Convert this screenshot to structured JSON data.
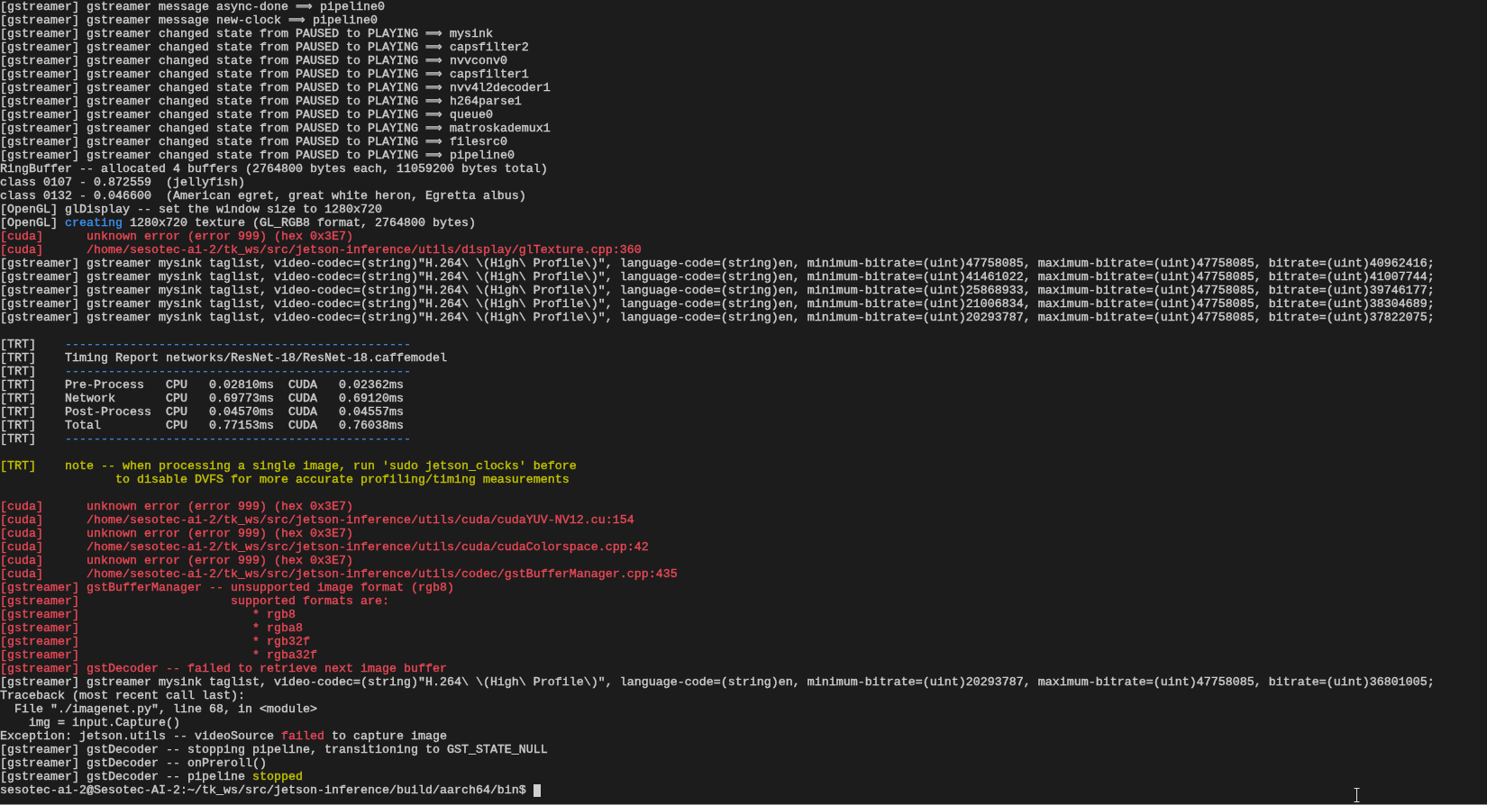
{
  "terminal": {
    "lines": [
      {
        "kind": "text",
        "segments": [
          {
            "text": "[gstreamer] gstreamer message async-done ⟹ pipeline0",
            "color": "#cccccc"
          }
        ]
      },
      {
        "kind": "text",
        "segments": [
          {
            "text": "[gstreamer] gstreamer message new-clock ⟹ pipeline0",
            "color": "#cccccc"
          }
        ]
      },
      {
        "kind": "text",
        "segments": [
          {
            "text": "[gstreamer] gstreamer changed state from PAUSED to PLAYING ⟹ mysink",
            "color": "#cccccc"
          }
        ]
      },
      {
        "kind": "text",
        "segments": [
          {
            "text": "[gstreamer] gstreamer changed state from PAUSED to PLAYING ⟹ capsfilter2",
            "color": "#cccccc"
          }
        ]
      },
      {
        "kind": "text",
        "segments": [
          {
            "text": "[gstreamer] gstreamer changed state from PAUSED to PLAYING ⟹ nvvconv0",
            "color": "#cccccc"
          }
        ]
      },
      {
        "kind": "text",
        "segments": [
          {
            "text": "[gstreamer] gstreamer changed state from PAUSED to PLAYING ⟹ capsfilter1",
            "color": "#cccccc"
          }
        ]
      },
      {
        "kind": "text",
        "segments": [
          {
            "text": "[gstreamer] gstreamer changed state from PAUSED to PLAYING ⟹ nvv4l2decoder1",
            "color": "#cccccc"
          }
        ]
      },
      {
        "kind": "text",
        "segments": [
          {
            "text": "[gstreamer] gstreamer changed state from PAUSED to PLAYING ⟹ h264parse1",
            "color": "#cccccc"
          }
        ]
      },
      {
        "kind": "text",
        "segments": [
          {
            "text": "[gstreamer] gstreamer changed state from PAUSED to PLAYING ⟹ queue0",
            "color": "#cccccc"
          }
        ]
      },
      {
        "kind": "text",
        "segments": [
          {
            "text": "[gstreamer] gstreamer changed state from PAUSED to PLAYING ⟹ matroskademux1",
            "color": "#cccccc"
          }
        ]
      },
      {
        "kind": "text",
        "segments": [
          {
            "text": "[gstreamer] gstreamer changed state from PAUSED to PLAYING ⟹ filesrc0",
            "color": "#cccccc"
          }
        ]
      },
      {
        "kind": "text",
        "segments": [
          {
            "text": "[gstreamer] gstreamer changed state from PAUSED to PLAYING ⟹ pipeline0",
            "color": "#cccccc"
          }
        ]
      },
      {
        "kind": "text",
        "segments": [
          {
            "text": "RingBuffer -- allocated 4 buffers (2764800 bytes each, 11059200 bytes total)",
            "color": "#cccccc"
          }
        ]
      },
      {
        "kind": "text",
        "segments": [
          {
            "text": "class 0107 - 0.872559  (jellyfish)",
            "color": "#cccccc"
          }
        ]
      },
      {
        "kind": "text",
        "segments": [
          {
            "text": "class 0132 - 0.046600  (American egret, great white heron, Egretta albus)",
            "color": "#cccccc"
          }
        ]
      },
      {
        "kind": "text",
        "segments": [
          {
            "text": "[OpenGL] glDisplay -- set the window size to 1280x720",
            "color": "#cccccc"
          }
        ]
      },
      {
        "kind": "text",
        "segments": [
          {
            "text": "[OpenGL] ",
            "color": "#cccccc"
          },
          {
            "text": "creating",
            "color": "#3b8eea"
          },
          {
            "text": " 1280x720 texture (GL_RGB8 format, 2764800 bytes)",
            "color": "#cccccc"
          }
        ]
      },
      {
        "kind": "text",
        "segments": [
          {
            "text": "[cuda]      unknown error (error 999) (hex 0x3E7)",
            "color": "#e74856"
          }
        ]
      },
      {
        "kind": "text",
        "segments": [
          {
            "text": "[cuda]      /home/sesotec-ai-2/tk_ws/src/jetson-inference/utils/display/glTexture.cpp:360",
            "color": "#e74856"
          }
        ]
      },
      {
        "kind": "text",
        "segments": [
          {
            "text": "[gstreamer] gstreamer mysink taglist, video-codec=(string)\"H.264\\ \\(High\\ Profile\\)\", language-code=(string)en, minimum-bitrate=(uint)47758085, maximum-bitrate=(uint)47758085, bitrate=(uint)40962416;",
            "color": "#cccccc"
          }
        ]
      },
      {
        "kind": "text",
        "segments": [
          {
            "text": "[gstreamer] gstreamer mysink taglist, video-codec=(string)\"H.264\\ \\(High\\ Profile\\)\", language-code=(string)en, minimum-bitrate=(uint)41461022, maximum-bitrate=(uint)47758085, bitrate=(uint)41007744;",
            "color": "#cccccc"
          }
        ]
      },
      {
        "kind": "text",
        "segments": [
          {
            "text": "[gstreamer] gstreamer mysink taglist, video-codec=(string)\"H.264\\ \\(High\\ Profile\\)\", language-code=(string)en, minimum-bitrate=(uint)25868933, maximum-bitrate=(uint)47758085, bitrate=(uint)39746177;",
            "color": "#cccccc"
          }
        ]
      },
      {
        "kind": "text",
        "segments": [
          {
            "text": "[gstreamer] gstreamer mysink taglist, video-codec=(string)\"H.264\\ \\(High\\ Profile\\)\", language-code=(string)en, minimum-bitrate=(uint)21006834, maximum-bitrate=(uint)47758085, bitrate=(uint)38304689;",
            "color": "#cccccc"
          }
        ]
      },
      {
        "kind": "text",
        "segments": [
          {
            "text": "[gstreamer] gstreamer mysink taglist, video-codec=(string)\"H.264\\ \\(High\\ Profile\\)\", language-code=(string)en, minimum-bitrate=(uint)20293787, maximum-bitrate=(uint)47758085, bitrate=(uint)37822075;",
            "color": "#cccccc"
          }
        ]
      },
      {
        "kind": "blank"
      },
      {
        "kind": "text",
        "segments": [
          {
            "text": "[TRT]    ",
            "color": "#cccccc"
          },
          {
            "text": "------------------------------------------------",
            "color": "#3b8eea"
          }
        ]
      },
      {
        "kind": "text",
        "segments": [
          {
            "text": "[TRT]    Timing Report networks/ResNet-18/ResNet-18.caffemodel",
            "color": "#cccccc"
          }
        ]
      },
      {
        "kind": "text",
        "segments": [
          {
            "text": "[TRT]    ",
            "color": "#cccccc"
          },
          {
            "text": "------------------------------------------------",
            "color": "#3b8eea"
          }
        ]
      },
      {
        "kind": "text",
        "segments": [
          {
            "text": "[TRT]    Pre-Process   CPU   0.02810ms  CUDA   0.02362ms",
            "color": "#cccccc"
          }
        ]
      },
      {
        "kind": "text",
        "segments": [
          {
            "text": "[TRT]    Network       CPU   0.69773ms  CUDA   0.69120ms",
            "color": "#cccccc"
          }
        ]
      },
      {
        "kind": "text",
        "segments": [
          {
            "text": "[TRT]    Post-Process  CPU   0.04570ms  CUDA   0.04557ms",
            "color": "#cccccc"
          }
        ]
      },
      {
        "kind": "text",
        "segments": [
          {
            "text": "[TRT]    Total         CPU   0.77153ms  CUDA   0.76038ms",
            "color": "#cccccc"
          }
        ]
      },
      {
        "kind": "text",
        "segments": [
          {
            "text": "[TRT]    ",
            "color": "#cccccc"
          },
          {
            "text": "------------------------------------------------",
            "color": "#3b8eea"
          }
        ]
      },
      {
        "kind": "blank"
      },
      {
        "kind": "text",
        "segments": [
          {
            "text": "[TRT]    note -- when processing a single image, run 'sudo jetson_clocks' before",
            "color": "#c1c100"
          }
        ]
      },
      {
        "kind": "text",
        "segments": [
          {
            "text": "                to disable DVFS for more accurate profiling/timing measurements",
            "color": "#c1c100"
          }
        ]
      },
      {
        "kind": "blank"
      },
      {
        "kind": "text",
        "segments": [
          {
            "text": "[cuda]      unknown error (error 999) (hex 0x3E7)",
            "color": "#e74856"
          }
        ]
      },
      {
        "kind": "text",
        "segments": [
          {
            "text": "[cuda]      /home/sesotec-ai-2/tk_ws/src/jetson-inference/utils/cuda/cudaYUV-NV12.cu:154",
            "color": "#e74856"
          }
        ]
      },
      {
        "kind": "text",
        "segments": [
          {
            "text": "[cuda]      unknown error (error 999) (hex 0x3E7)",
            "color": "#e74856"
          }
        ]
      },
      {
        "kind": "text",
        "segments": [
          {
            "text": "[cuda]      /home/sesotec-ai-2/tk_ws/src/jetson-inference/utils/cuda/cudaColorspace.cpp:42",
            "color": "#e74856"
          }
        ]
      },
      {
        "kind": "text",
        "segments": [
          {
            "text": "[cuda]      unknown error (error 999) (hex 0x3E7)",
            "color": "#e74856"
          }
        ]
      },
      {
        "kind": "text",
        "segments": [
          {
            "text": "[cuda]      /home/sesotec-ai-2/tk_ws/src/jetson-inference/utils/codec/gstBufferManager.cpp:435",
            "color": "#e74856"
          }
        ]
      },
      {
        "kind": "text",
        "segments": [
          {
            "text": "[gstreamer] gstBufferManager -- unsupported image format (rgb8)",
            "color": "#e74856"
          }
        ]
      },
      {
        "kind": "text",
        "segments": [
          {
            "text": "[gstreamer]                     supported formats are:",
            "color": "#e74856"
          }
        ]
      },
      {
        "kind": "text",
        "segments": [
          {
            "text": "[gstreamer]                        * rgb8",
            "color": "#e74856"
          }
        ]
      },
      {
        "kind": "text",
        "segments": [
          {
            "text": "[gstreamer]                        * rgba8",
            "color": "#e74856"
          }
        ]
      },
      {
        "kind": "text",
        "segments": [
          {
            "text": "[gstreamer]                        * rgb32f",
            "color": "#e74856"
          }
        ]
      },
      {
        "kind": "text",
        "segments": [
          {
            "text": "[gstreamer]                        * rgba32f",
            "color": "#e74856"
          }
        ]
      },
      {
        "kind": "text",
        "segments": [
          {
            "text": "[gstreamer] gstDecoder -- failed to retrieve next image buffer",
            "color": "#e74856"
          }
        ]
      },
      {
        "kind": "text",
        "segments": [
          {
            "text": "[gstreamer] gstreamer mysink taglist, video-codec=(string)\"H.264\\ \\(High\\ Profile\\)\", language-code=(string)en, minimum-bitrate=(uint)20293787, maximum-bitrate=(uint)47758085, bitrate=(uint)36801005;",
            "color": "#cccccc"
          }
        ]
      },
      {
        "kind": "text",
        "segments": [
          {
            "text": "Traceback (most recent call last):",
            "color": "#cccccc"
          }
        ]
      },
      {
        "kind": "text",
        "segments": [
          {
            "text": "  File \"./imagenet.py\", line 68, in <module>",
            "color": "#cccccc"
          }
        ]
      },
      {
        "kind": "text",
        "segments": [
          {
            "text": "    img = input.Capture()",
            "color": "#cccccc"
          }
        ]
      },
      {
        "kind": "text",
        "segments": [
          {
            "text": "Exception: jetson.utils -- videoSource ",
            "color": "#cccccc"
          },
          {
            "text": "failed",
            "color": "#e74856"
          },
          {
            "text": " to capture image",
            "color": "#cccccc"
          }
        ]
      },
      {
        "kind": "text",
        "segments": [
          {
            "text": "[gstreamer] gstDecoder -- stopping pipeline, transitioning to GST_STATE_NULL",
            "color": "#cccccc"
          }
        ]
      },
      {
        "kind": "text",
        "segments": [
          {
            "text": "[gstreamer] gstDecoder -- onPreroll()",
            "color": "#cccccc"
          }
        ]
      },
      {
        "kind": "text",
        "segments": [
          {
            "text": "[gstreamer] gstDecoder -- pipeline ",
            "color": "#cccccc"
          },
          {
            "text": "stopped",
            "color": "#c1c100"
          }
        ]
      },
      {
        "kind": "prompt",
        "segments": [
          {
            "text": "sesotec-ai-2@Sesotec-AI-2:~/tk_ws/src/jetson-inference/build/aarch64/bin$ ",
            "color": "#cccccc"
          }
        ]
      }
    ]
  }
}
